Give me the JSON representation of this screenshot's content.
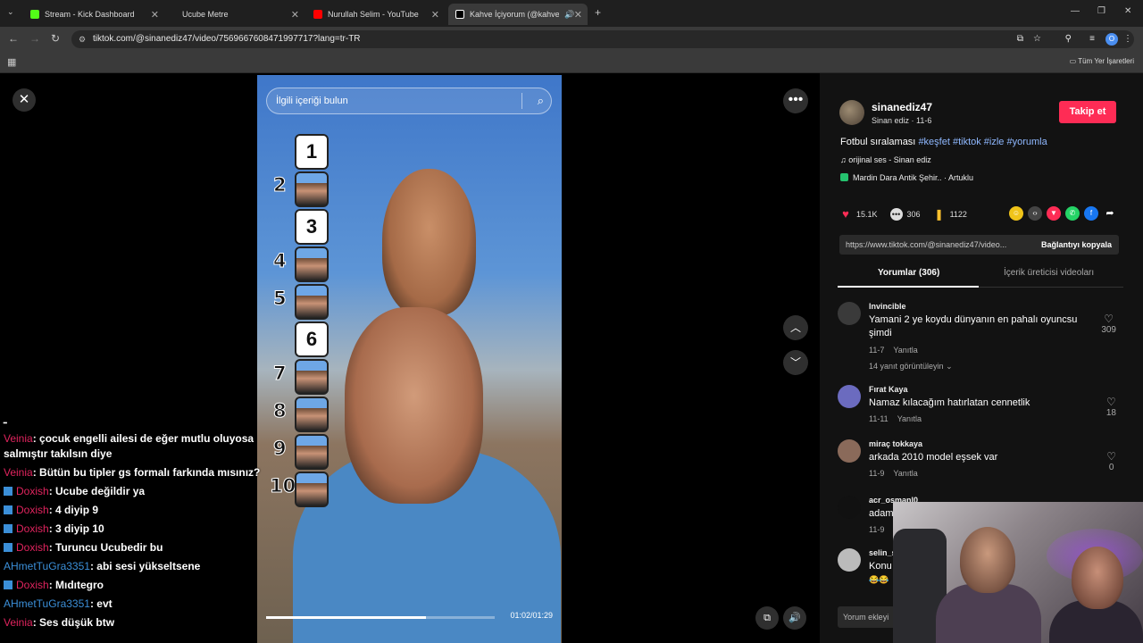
{
  "browser": {
    "tabs": [
      {
        "label": "Stream - Kick Dashboard",
        "color": "#53fc18"
      },
      {
        "label": "Ucube Metre",
        "color": ""
      },
      {
        "label": "Nurullah Selim - YouTube",
        "color": "#ff0000"
      },
      {
        "label": "Kahve İçiyorum (@kahve.iy",
        "color": "#ffffff"
      }
    ],
    "url": "tiktok.com/@sinanediz47/video/7569667608471997717?lang=tr-TR",
    "bookmarks_label": "Tüm Yer İşaretleri"
  },
  "video": {
    "search_placeholder": "İlgili içeriği bulun",
    "ranks": [
      "1",
      "2",
      "3",
      "4",
      "5",
      "6",
      "7",
      "8",
      "9",
      "10"
    ],
    "box_numbers": {
      "1": "1",
      "3": "3",
      "6": "6"
    },
    "time": "01:02/01:29",
    "progress": 0.7
  },
  "chat": [
    {
      "user": "",
      "text": "ـ",
      "user_color": "#ffffff",
      "badge": false
    },
    {
      "user": "Veinia",
      "text": ": çocuk engelli ailesi de eğer mutlu oluyosa salmıştır takılsın diye",
      "user_color": "#e0245e",
      "badge": false
    },
    {
      "user": "Veinia",
      "text": ": Bütün bu tipler gs formalı farkında mısınız?",
      "user_color": "#e0245e",
      "badge": false
    },
    {
      "user": "Doxish",
      "text": ": Ucube değildir ya",
      "user_color": "#e0245e",
      "badge": true
    },
    {
      "user": "Doxish",
      "text": ": 4 diyip 9",
      "user_color": "#e0245e",
      "badge": true
    },
    {
      "user": "Doxish",
      "text": ": 3 diyip 10",
      "user_color": "#e0245e",
      "badge": true
    },
    {
      "user": "Doxish",
      "text": ": Turuncu Ucubedir bu",
      "user_color": "#e0245e",
      "badge": true
    },
    {
      "user": "AHmetTuGra3351",
      "text": ": abi sesi yükseltsene",
      "user_color": "#3b8fd8",
      "badge": false
    },
    {
      "user": "Doxish",
      "text": ": Mıdıtegro",
      "user_color": "#e0245e",
      "badge": true
    },
    {
      "user": "AHmetTuGra3351",
      "text": ": evt",
      "user_color": "#3b8fd8",
      "badge": false
    },
    {
      "user": "Veinia",
      "text": ": Ses düşük btw",
      "user_color": "#e0245e",
      "badge": false
    }
  ],
  "post": {
    "username": "sinanediz47",
    "subtitle": "Sinan ediz · 11-6",
    "follow_label": "Takip et",
    "description": "Fotbul sıralaması",
    "hashtags": "#keşfet #tiktok #izle #yorumla",
    "music": "orijinal ses - Sinan ediz",
    "location": "Mardin Dara Antik Şehir.. · Artuklu",
    "likes": "15.1K",
    "comments": "306",
    "saves": "1122",
    "link": "https://www.tiktok.com/@sinanediz47/video...",
    "copy_label": "Bağlantıyı kopyala",
    "tab_comments": "Yorumlar (306)",
    "tab_creator": "İçerik üreticisi videoları",
    "comment_input": "Yorum ekleyi"
  },
  "comments": [
    {
      "name": "Invincible",
      "text": "Yamani 2 ye koydu dünyanın en pahalı oyuncsu şimdi",
      "date": "11-7",
      "reply": "Yanıtla",
      "likes": "309",
      "more": "14 yanıt görüntüleyin",
      "avatar": "#3a3a3a"
    },
    {
      "name": "Fırat Kaya",
      "text": "Namaz kılacağım hatırlatan cennetlik",
      "date": "11-11",
      "reply": "Yanıtla",
      "likes": "18",
      "avatar": "#6b6bbf"
    },
    {
      "name": "miraç tokkaya",
      "text": "arkada 2010 model eşsek var",
      "date": "11-9",
      "reply": "Yanıtla",
      "likes": "0",
      "avatar": "#8a6a5a"
    },
    {
      "name": "acr_osmanl0",
      "text": "adam",
      "date": "11-9",
      "reply": "",
      "likes": "",
      "avatar": "#111111"
    },
    {
      "name": "selin_s",
      "text": "Konu",
      "date": "😂😂",
      "reply": "",
      "likes": "",
      "avatar": "#bbbbbb"
    }
  ]
}
